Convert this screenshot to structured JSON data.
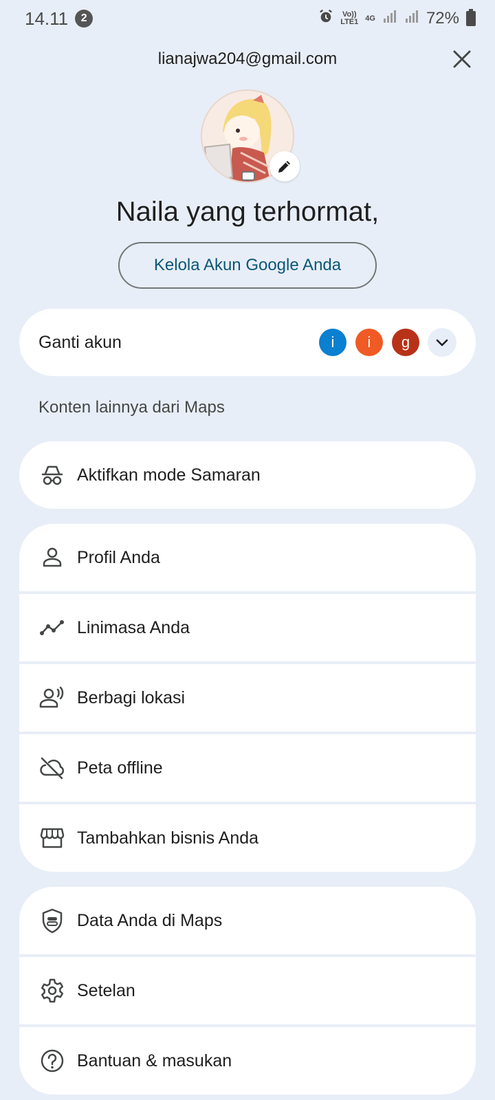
{
  "status_bar": {
    "time": "14.11",
    "notification_count": "2",
    "network_top": "Vo))",
    "network_bottom": "LTE1",
    "network_type": "4G",
    "battery": "72%"
  },
  "header": {
    "email": "lianajwa204@gmail.com",
    "greeting": "Naila yang terhormat,",
    "manage_account_label": "Kelola Akun Google Anda"
  },
  "switch_account": {
    "label": "Ganti akun",
    "accounts": [
      {
        "initial": "i",
        "color": "#0b7fd0"
      },
      {
        "initial": "i",
        "color": "#f05a24"
      },
      {
        "initial": "g",
        "color": "#b83218"
      }
    ]
  },
  "section_title": "Konten lainnya dari Maps",
  "incognito": {
    "label": "Aktifkan mode Samaran",
    "icon": "incognito-icon"
  },
  "menu_main": [
    {
      "label": "Profil Anda",
      "icon": "person-icon"
    },
    {
      "label": "Linimasa Anda",
      "icon": "timeline-icon"
    },
    {
      "label": "Berbagi lokasi",
      "icon": "location-sharing-icon"
    },
    {
      "label": "Peta offline",
      "icon": "cloud-off-icon"
    },
    {
      "label": "Tambahkan bisnis Anda",
      "icon": "storefront-icon"
    }
  ],
  "menu_settings": [
    {
      "label": "Data Anda di Maps",
      "icon": "shield-icon"
    },
    {
      "label": "Setelan",
      "icon": "gear-icon"
    },
    {
      "label": "Bantuan & masukan",
      "icon": "help-icon"
    }
  ]
}
